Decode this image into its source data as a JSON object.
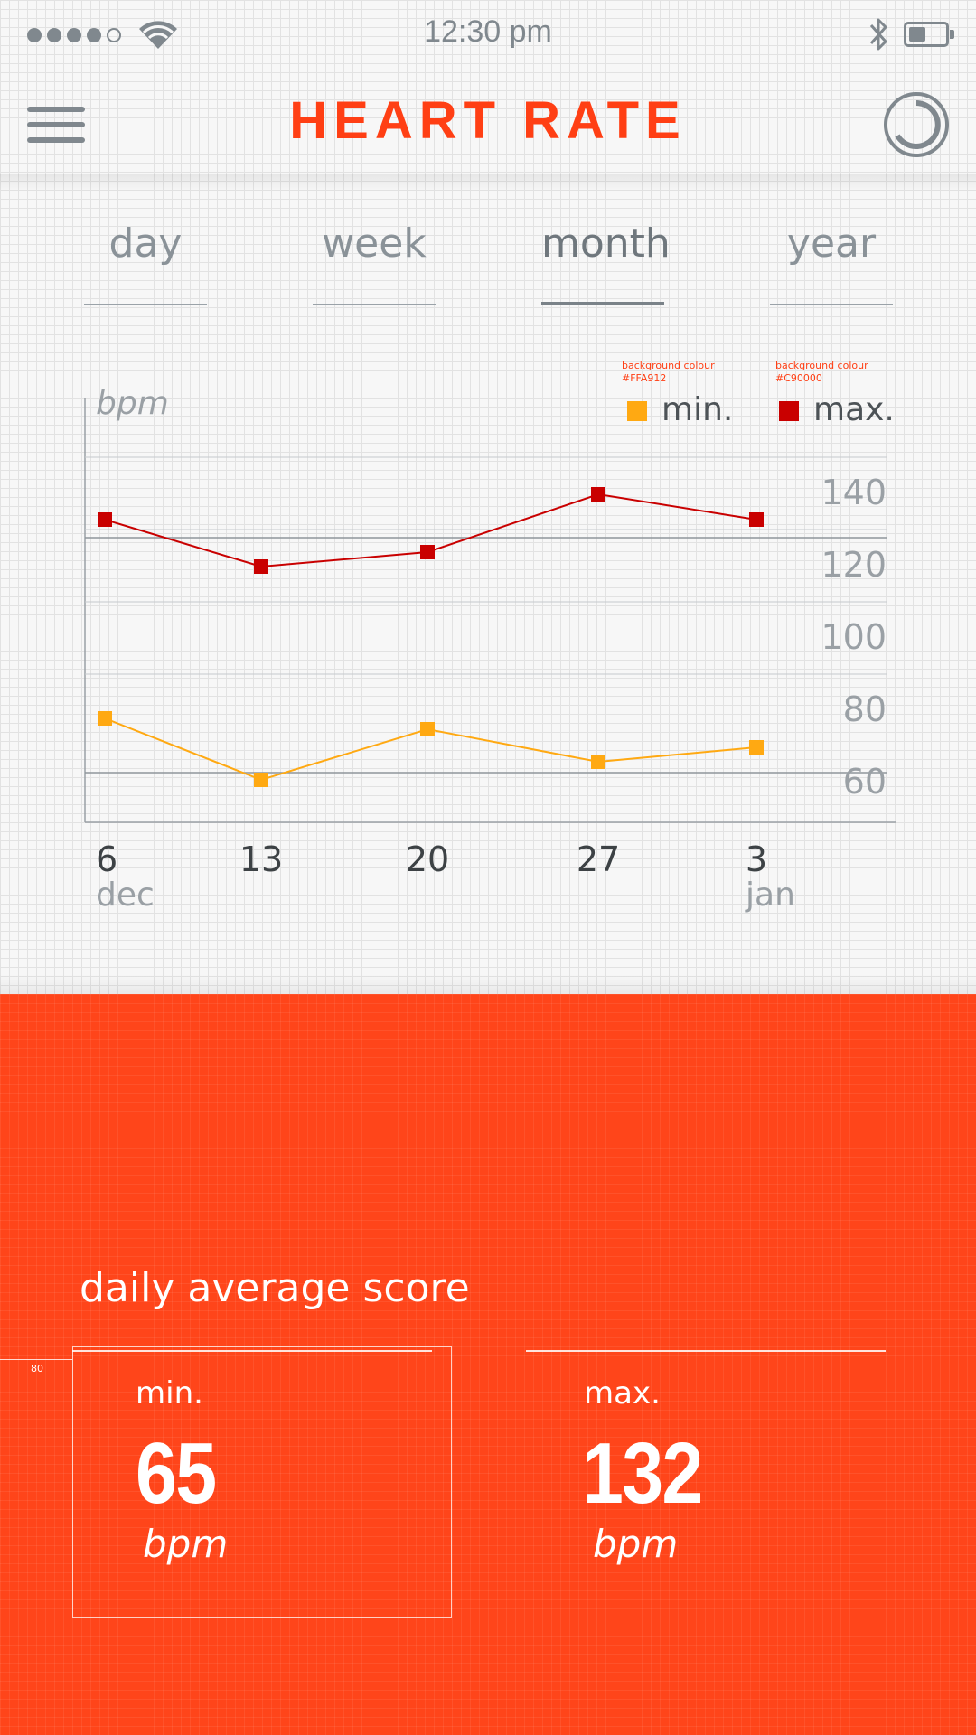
{
  "status_bar": {
    "time": "12:30 pm",
    "signal_bars_filled": 4,
    "signal_bars_total": 5,
    "icons": [
      "signal-dots-icon",
      "wifi-icon",
      "bluetooth-icon",
      "battery-icon"
    ]
  },
  "header": {
    "title": "HEART RATE",
    "menu_icon": "hamburger-menu-icon",
    "refresh_icon": "refresh-icon"
  },
  "tabs": [
    {
      "label": "day",
      "active": false
    },
    {
      "label": "week",
      "active": false
    },
    {
      "label": "month",
      "active": true
    },
    {
      "label": "year",
      "active": false
    }
  ],
  "colors": {
    "accent": "#FF3F14",
    "panel_background": "#FF451A",
    "min_series": "#FFA912",
    "max_series": "#C90000",
    "text_grey": "#8A9298"
  },
  "annotations": {
    "min_note_line1": "background colour",
    "min_note_line2": "#FFA912",
    "max_note_line1": "background colour",
    "max_note_line2": "#C90000",
    "guide_value": "80"
  },
  "chart_data": {
    "type": "line",
    "ylabel": "bpm",
    "yticks": [
      140,
      120,
      100,
      80,
      60
    ],
    "ylim": [
      55,
      155
    ],
    "reference_lines": [
      127,
      62
    ],
    "grid": true,
    "legend_placement": "top-right",
    "categories": [
      "6",
      "13",
      "20",
      "27",
      "3"
    ],
    "category_sublabels": [
      "dec",
      "",
      "",
      "",
      "jan"
    ],
    "series": [
      {
        "name": "min.",
        "color": "#FFA912",
        "values": [
          77,
          60,
          74,
          65,
          69
        ]
      },
      {
        "name": "max.",
        "color": "#C90000",
        "values": [
          132,
          119,
          123,
          139,
          132
        ]
      }
    ]
  },
  "summary": {
    "heading": "daily average score",
    "min": {
      "label": "min.",
      "value": "65",
      "unit": "bpm"
    },
    "max": {
      "label": "max.",
      "value": "132",
      "unit": "bpm"
    }
  }
}
